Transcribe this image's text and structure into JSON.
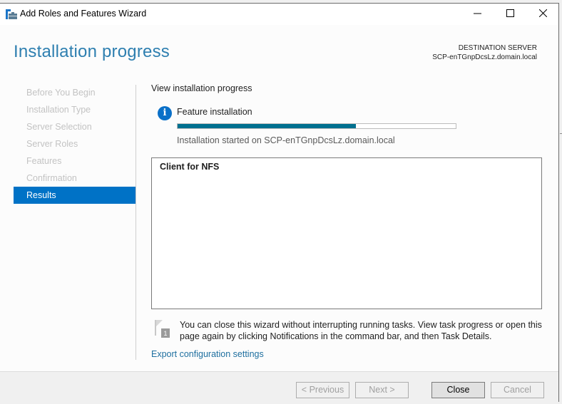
{
  "window": {
    "title": "Add Roles and Features Wizard",
    "app_icon": "server-manager-icon",
    "controls": {
      "minimize": "minimize-icon",
      "maximize": "maximize-icon",
      "close": "close-icon"
    }
  },
  "header": {
    "page_title": "Installation progress",
    "destination_label": "DESTINATION SERVER",
    "destination_server": "SCP-enTGnpDcsLz.domain.local"
  },
  "nav": {
    "items": [
      {
        "label": "Before You Begin",
        "active": false
      },
      {
        "label": "Installation Type",
        "active": false
      },
      {
        "label": "Server Selection",
        "active": false
      },
      {
        "label": "Server Roles",
        "active": false
      },
      {
        "label": "Features",
        "active": false
      },
      {
        "label": "Confirmation",
        "active": false
      },
      {
        "label": "Results",
        "active": true
      }
    ]
  },
  "content": {
    "subheading": "View installation progress",
    "status_icon": "info-icon",
    "feature_label": "Feature installation",
    "progress_percent": 64,
    "progress_color": "#00708f",
    "started_text": "Installation started on SCP-enTGnpDcsLz.domain.local",
    "results": [
      "Client for NFS"
    ],
    "note_icon": "notification-flag-icon",
    "note_badge": "1",
    "note_text": "You can close this wizard without interrupting running tasks. View task progress or open this page again by clicking Notifications in the command bar, and then Task Details.",
    "export_link": "Export configuration settings"
  },
  "footer": {
    "previous_label": "< Previous",
    "next_label": "Next >",
    "close_label": "Close",
    "cancel_label": "Cancel"
  },
  "colors": {
    "accent": "#0072c6",
    "title": "#2e7fb0",
    "link": "#1e6f9f"
  }
}
